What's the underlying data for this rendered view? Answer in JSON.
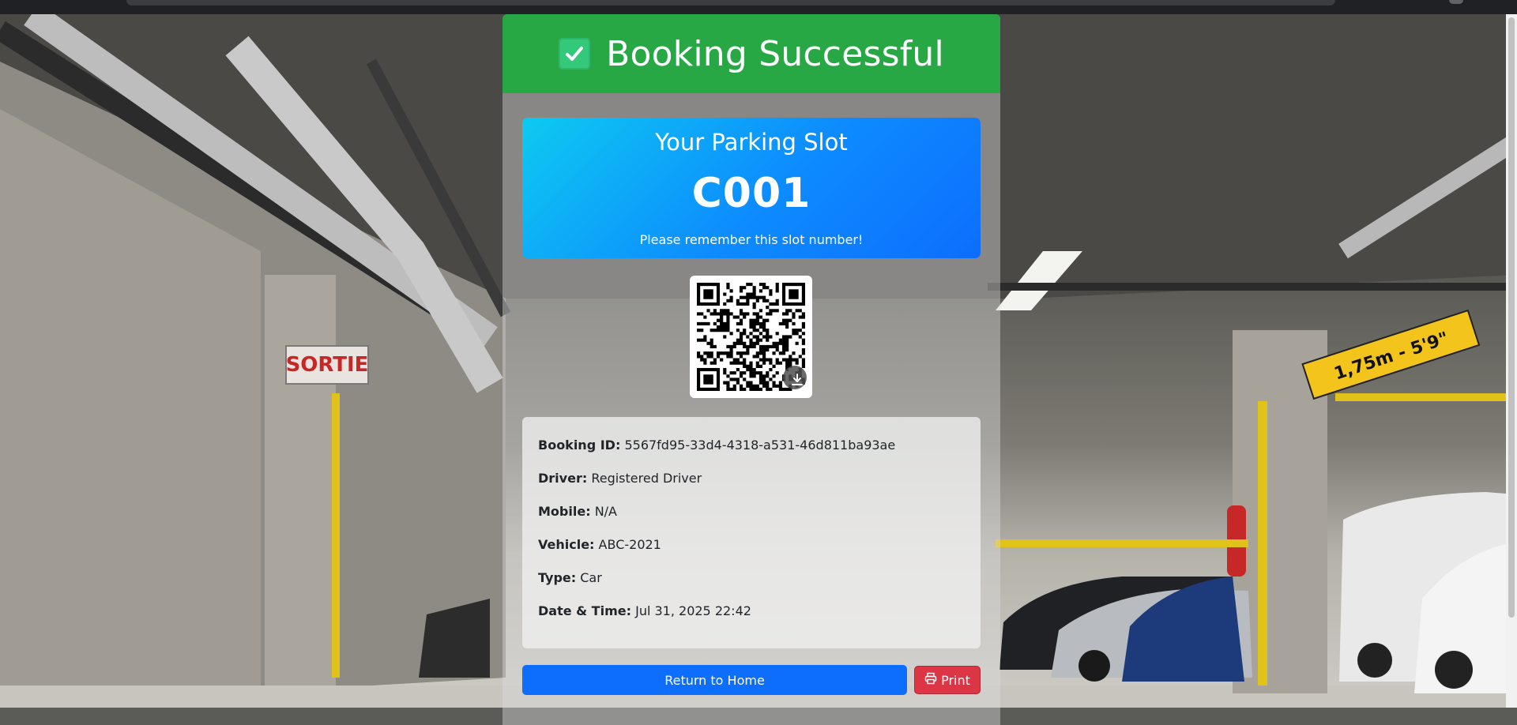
{
  "header": {
    "title": "Booking Successful",
    "icon": "check-box-icon",
    "bg_color": "#28a745"
  },
  "slot": {
    "heading": "Your Parking Slot",
    "number": "C001",
    "note": "Please remember this slot number!"
  },
  "qr": {
    "icon": "qr-code-icon",
    "download_icon": "download-icon"
  },
  "details": [
    {
      "label": "Booking ID:",
      "value": "5567fd95-33d4-4318-a531-46d811ba93ae"
    },
    {
      "label": "Driver:",
      "value": "Registered Driver"
    },
    {
      "label": "Mobile:",
      "value": "N/A"
    },
    {
      "label": "Vehicle:",
      "value": "ABC-2021"
    },
    {
      "label": "Type:",
      "value": "Car"
    },
    {
      "label": "Date & Time:",
      "value": "Jul 31, 2025 22:42"
    }
  ],
  "actions": {
    "home_label": "Return to Home",
    "print_label": "Print",
    "home_color": "#0d6efd",
    "print_color": "#dc3545"
  },
  "background": {
    "exit_sign_text": "SORTIE",
    "clearance_sign_text": "1,75m - 5'9\""
  }
}
